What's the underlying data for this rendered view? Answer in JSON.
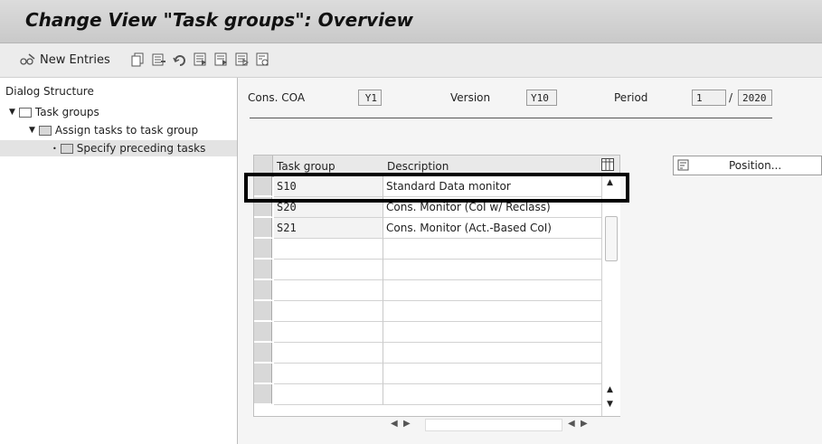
{
  "title": "Change View \"Task groups\": Overview",
  "toolbar": {
    "new_entries_label": "New Entries",
    "icons": [
      "glasses-edit-icon",
      "copy-icon",
      "delete-icon",
      "undo-icon",
      "select-all-icon",
      "select-block-icon",
      "deselect-all-icon",
      "configuration-icon"
    ]
  },
  "dialog_structure": {
    "title": "Dialog Structure",
    "items": [
      {
        "label": "Task groups",
        "level": 1,
        "expanded": true
      },
      {
        "label": "Assign tasks to task group",
        "level": 2,
        "expanded": true
      },
      {
        "label": "Specify preceding tasks",
        "level": 3,
        "selected": true
      }
    ]
  },
  "header_fields": {
    "cons_coa_label": "Cons. COA",
    "cons_coa_value": "Y1",
    "version_label": "Version",
    "version_value": "Y10",
    "period_label": "Period",
    "period_value": "1",
    "period_sep": "/",
    "year_value": "2020"
  },
  "table": {
    "columns": [
      "Task group",
      "Description"
    ],
    "rows": [
      {
        "task_group": "S10",
        "description": "Standard Data monitor"
      },
      {
        "task_group": "S20",
        "description": "Cons. Monitor (CoI w/ Reclass)"
      },
      {
        "task_group": "S21",
        "description": "Cons. Monitor (Act.-Based CoI)"
      }
    ],
    "empty_rows": 8
  },
  "position_button_label": "Position..."
}
